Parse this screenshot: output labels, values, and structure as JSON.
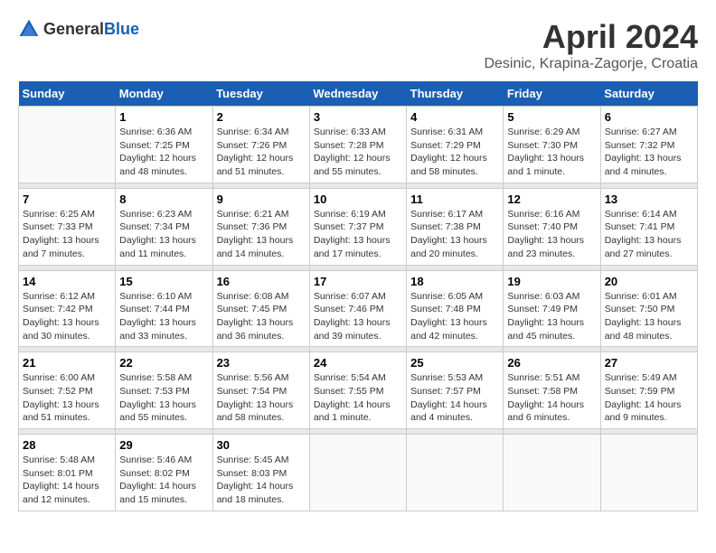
{
  "header": {
    "logo_general": "General",
    "logo_blue": "Blue",
    "month": "April 2024",
    "location": "Desinic, Krapina-Zagorje, Croatia"
  },
  "weekdays": [
    "Sunday",
    "Monday",
    "Tuesday",
    "Wednesday",
    "Thursday",
    "Friday",
    "Saturday"
  ],
  "weeks": [
    [
      {
        "day": "",
        "sunrise": "",
        "sunset": "",
        "daylight": ""
      },
      {
        "day": "1",
        "sunrise": "Sunrise: 6:36 AM",
        "sunset": "Sunset: 7:25 PM",
        "daylight": "Daylight: 12 hours and 48 minutes."
      },
      {
        "day": "2",
        "sunrise": "Sunrise: 6:34 AM",
        "sunset": "Sunset: 7:26 PM",
        "daylight": "Daylight: 12 hours and 51 minutes."
      },
      {
        "day": "3",
        "sunrise": "Sunrise: 6:33 AM",
        "sunset": "Sunset: 7:28 PM",
        "daylight": "Daylight: 12 hours and 55 minutes."
      },
      {
        "day": "4",
        "sunrise": "Sunrise: 6:31 AM",
        "sunset": "Sunset: 7:29 PM",
        "daylight": "Daylight: 12 hours and 58 minutes."
      },
      {
        "day": "5",
        "sunrise": "Sunrise: 6:29 AM",
        "sunset": "Sunset: 7:30 PM",
        "daylight": "Daylight: 13 hours and 1 minute."
      },
      {
        "day": "6",
        "sunrise": "Sunrise: 6:27 AM",
        "sunset": "Sunset: 7:32 PM",
        "daylight": "Daylight: 13 hours and 4 minutes."
      }
    ],
    [
      {
        "day": "7",
        "sunrise": "Sunrise: 6:25 AM",
        "sunset": "Sunset: 7:33 PM",
        "daylight": "Daylight: 13 hours and 7 minutes."
      },
      {
        "day": "8",
        "sunrise": "Sunrise: 6:23 AM",
        "sunset": "Sunset: 7:34 PM",
        "daylight": "Daylight: 13 hours and 11 minutes."
      },
      {
        "day": "9",
        "sunrise": "Sunrise: 6:21 AM",
        "sunset": "Sunset: 7:36 PM",
        "daylight": "Daylight: 13 hours and 14 minutes."
      },
      {
        "day": "10",
        "sunrise": "Sunrise: 6:19 AM",
        "sunset": "Sunset: 7:37 PM",
        "daylight": "Daylight: 13 hours and 17 minutes."
      },
      {
        "day": "11",
        "sunrise": "Sunrise: 6:17 AM",
        "sunset": "Sunset: 7:38 PM",
        "daylight": "Daylight: 13 hours and 20 minutes."
      },
      {
        "day": "12",
        "sunrise": "Sunrise: 6:16 AM",
        "sunset": "Sunset: 7:40 PM",
        "daylight": "Daylight: 13 hours and 23 minutes."
      },
      {
        "day": "13",
        "sunrise": "Sunrise: 6:14 AM",
        "sunset": "Sunset: 7:41 PM",
        "daylight": "Daylight: 13 hours and 27 minutes."
      }
    ],
    [
      {
        "day": "14",
        "sunrise": "Sunrise: 6:12 AM",
        "sunset": "Sunset: 7:42 PM",
        "daylight": "Daylight: 13 hours and 30 minutes."
      },
      {
        "day": "15",
        "sunrise": "Sunrise: 6:10 AM",
        "sunset": "Sunset: 7:44 PM",
        "daylight": "Daylight: 13 hours and 33 minutes."
      },
      {
        "day": "16",
        "sunrise": "Sunrise: 6:08 AM",
        "sunset": "Sunset: 7:45 PM",
        "daylight": "Daylight: 13 hours and 36 minutes."
      },
      {
        "day": "17",
        "sunrise": "Sunrise: 6:07 AM",
        "sunset": "Sunset: 7:46 PM",
        "daylight": "Daylight: 13 hours and 39 minutes."
      },
      {
        "day": "18",
        "sunrise": "Sunrise: 6:05 AM",
        "sunset": "Sunset: 7:48 PM",
        "daylight": "Daylight: 13 hours and 42 minutes."
      },
      {
        "day": "19",
        "sunrise": "Sunrise: 6:03 AM",
        "sunset": "Sunset: 7:49 PM",
        "daylight": "Daylight: 13 hours and 45 minutes."
      },
      {
        "day": "20",
        "sunrise": "Sunrise: 6:01 AM",
        "sunset": "Sunset: 7:50 PM",
        "daylight": "Daylight: 13 hours and 48 minutes."
      }
    ],
    [
      {
        "day": "21",
        "sunrise": "Sunrise: 6:00 AM",
        "sunset": "Sunset: 7:52 PM",
        "daylight": "Daylight: 13 hours and 51 minutes."
      },
      {
        "day": "22",
        "sunrise": "Sunrise: 5:58 AM",
        "sunset": "Sunset: 7:53 PM",
        "daylight": "Daylight: 13 hours and 55 minutes."
      },
      {
        "day": "23",
        "sunrise": "Sunrise: 5:56 AM",
        "sunset": "Sunset: 7:54 PM",
        "daylight": "Daylight: 13 hours and 58 minutes."
      },
      {
        "day": "24",
        "sunrise": "Sunrise: 5:54 AM",
        "sunset": "Sunset: 7:55 PM",
        "daylight": "Daylight: 14 hours and 1 minute."
      },
      {
        "day": "25",
        "sunrise": "Sunrise: 5:53 AM",
        "sunset": "Sunset: 7:57 PM",
        "daylight": "Daylight: 14 hours and 4 minutes."
      },
      {
        "day": "26",
        "sunrise": "Sunrise: 5:51 AM",
        "sunset": "Sunset: 7:58 PM",
        "daylight": "Daylight: 14 hours and 6 minutes."
      },
      {
        "day": "27",
        "sunrise": "Sunrise: 5:49 AM",
        "sunset": "Sunset: 7:59 PM",
        "daylight": "Daylight: 14 hours and 9 minutes."
      }
    ],
    [
      {
        "day": "28",
        "sunrise": "Sunrise: 5:48 AM",
        "sunset": "Sunset: 8:01 PM",
        "daylight": "Daylight: 14 hours and 12 minutes."
      },
      {
        "day": "29",
        "sunrise": "Sunrise: 5:46 AM",
        "sunset": "Sunset: 8:02 PM",
        "daylight": "Daylight: 14 hours and 15 minutes."
      },
      {
        "day": "30",
        "sunrise": "Sunrise: 5:45 AM",
        "sunset": "Sunset: 8:03 PM",
        "daylight": "Daylight: 14 hours and 18 minutes."
      },
      {
        "day": "",
        "sunrise": "",
        "sunset": "",
        "daylight": ""
      },
      {
        "day": "",
        "sunrise": "",
        "sunset": "",
        "daylight": ""
      },
      {
        "day": "",
        "sunrise": "",
        "sunset": "",
        "daylight": ""
      },
      {
        "day": "",
        "sunrise": "",
        "sunset": "",
        "daylight": ""
      }
    ]
  ]
}
